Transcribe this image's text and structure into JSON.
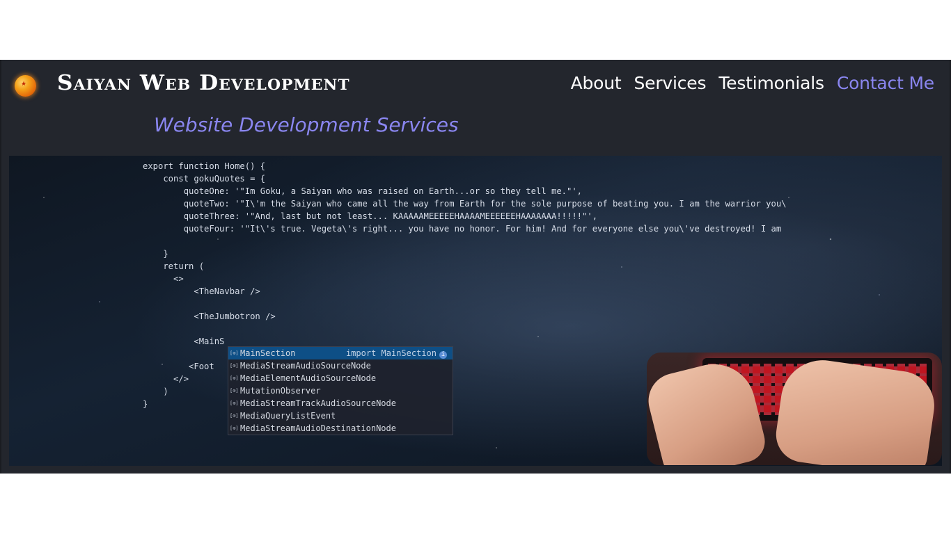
{
  "brand": {
    "name": "Saiyan Web Development",
    "logo_icon": "dragon-ball-icon"
  },
  "nav": {
    "items": [
      {
        "label": "About",
        "active": false
      },
      {
        "label": "Services",
        "active": false
      },
      {
        "label": "Testimonials",
        "active": false
      },
      {
        "label": "Contact Me",
        "active": true
      }
    ]
  },
  "tagline": "Website Development Services",
  "hero": {
    "code_lines": [
      "export function Home() {",
      "    const gokuQuotes = {",
      "        quoteOne: '\"Im Goku, a Saiyan who was raised on Earth...or so they tell me.\"',",
      "        quoteTwo: '\"I\\'m the Saiyan who came all the way from Earth for the sole purpose of beating you. I am the warrior you\\",
      "        quoteThree: '\"And, last but not least... KAAAAAMEEEEEHAAAAMEEEEEEHAAAAAAA!!!!!\"',",
      "        quoteFour: '\"It\\'s true. Vegeta\\'s right... you have no honor. For him! And for everyone else you\\'ve destroyed! I am",
      "",
      "    }",
      "    return (",
      "      <>",
      "          <TheNavbar />",
      "",
      "          <TheJumbotron />",
      "",
      "          <MainS",
      "",
      "         <Foot",
      "      </>",
      "    )",
      "}"
    ],
    "autocomplete": [
      {
        "label": "MainSection",
        "detail": "import MainSection",
        "selected": true
      },
      {
        "label": "MediaStreamAudioSourceNode",
        "detail": "",
        "selected": false
      },
      {
        "label": "MediaElementAudioSourceNode",
        "detail": "",
        "selected": false
      },
      {
        "label": "MutationObserver",
        "detail": "",
        "selected": false
      },
      {
        "label": "MediaStreamTrackAudioSourceNode",
        "detail": "",
        "selected": false
      },
      {
        "label": "MediaQueryListEvent",
        "detail": "",
        "selected": false
      },
      {
        "label": "MediaStreamAudioDestinationNode",
        "detail": "",
        "selected": false
      }
    ],
    "autocomplete_item_icon": "symbol-variable-icon",
    "keyboard_image": "hands-typing-on-red-backlit-keyboard"
  },
  "colors": {
    "header_bg": "#23262d",
    "accent": "#8a86f0",
    "nav_text": "#ffffff",
    "autocomplete_selected": "#0e4f86"
  }
}
